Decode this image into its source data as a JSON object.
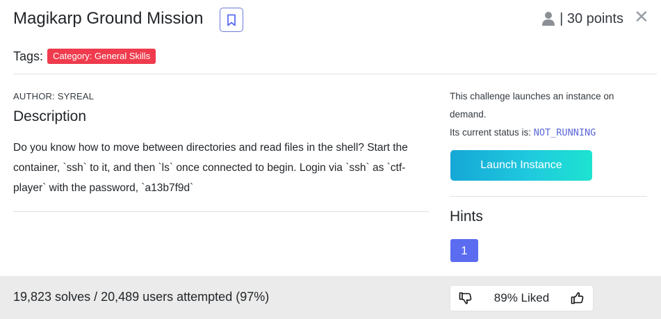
{
  "header": {
    "title": "Magikarp Ground Mission",
    "points": "| 30 points",
    "close_glyph": "✕"
  },
  "tags": {
    "label": "Tags:",
    "items": [
      {
        "label": "Category: General Skills",
        "color": "#ef3b4d"
      }
    ]
  },
  "challenge": {
    "author": "AUTHOR: SYREAL",
    "description_heading": "Description",
    "description": "Do you know how to move between directories and read files in the shell? Start the container, `ssh` to it, and then `ls` once connected to begin. Login via `ssh` as `ctf-player` with the password, `a13b7f9d`"
  },
  "instance": {
    "info_line": "This challenge launches an instance on demand.",
    "status_label": "Its current status is: ",
    "status_value": "NOT_RUNNING",
    "launch_label": "Launch Instance"
  },
  "hints": {
    "heading": "Hints",
    "items": [
      "1"
    ]
  },
  "footer": {
    "solves_text": "19,823 solves / 20,489 users attempted (97%)",
    "liked_text": "89% Liked"
  },
  "icons": {
    "bookmark": "bookmark-icon",
    "user": "user-icon",
    "close": "close-icon",
    "thumbs_down": "thumbs-down-icon",
    "thumbs_up": "thumbs-up-icon"
  },
  "colors": {
    "accent": "#5b6cf0",
    "tag": "#ef3b4d",
    "launch_start": "#16a7d6",
    "launch_end": "#1ee3d0",
    "status": "#5a67d8"
  }
}
